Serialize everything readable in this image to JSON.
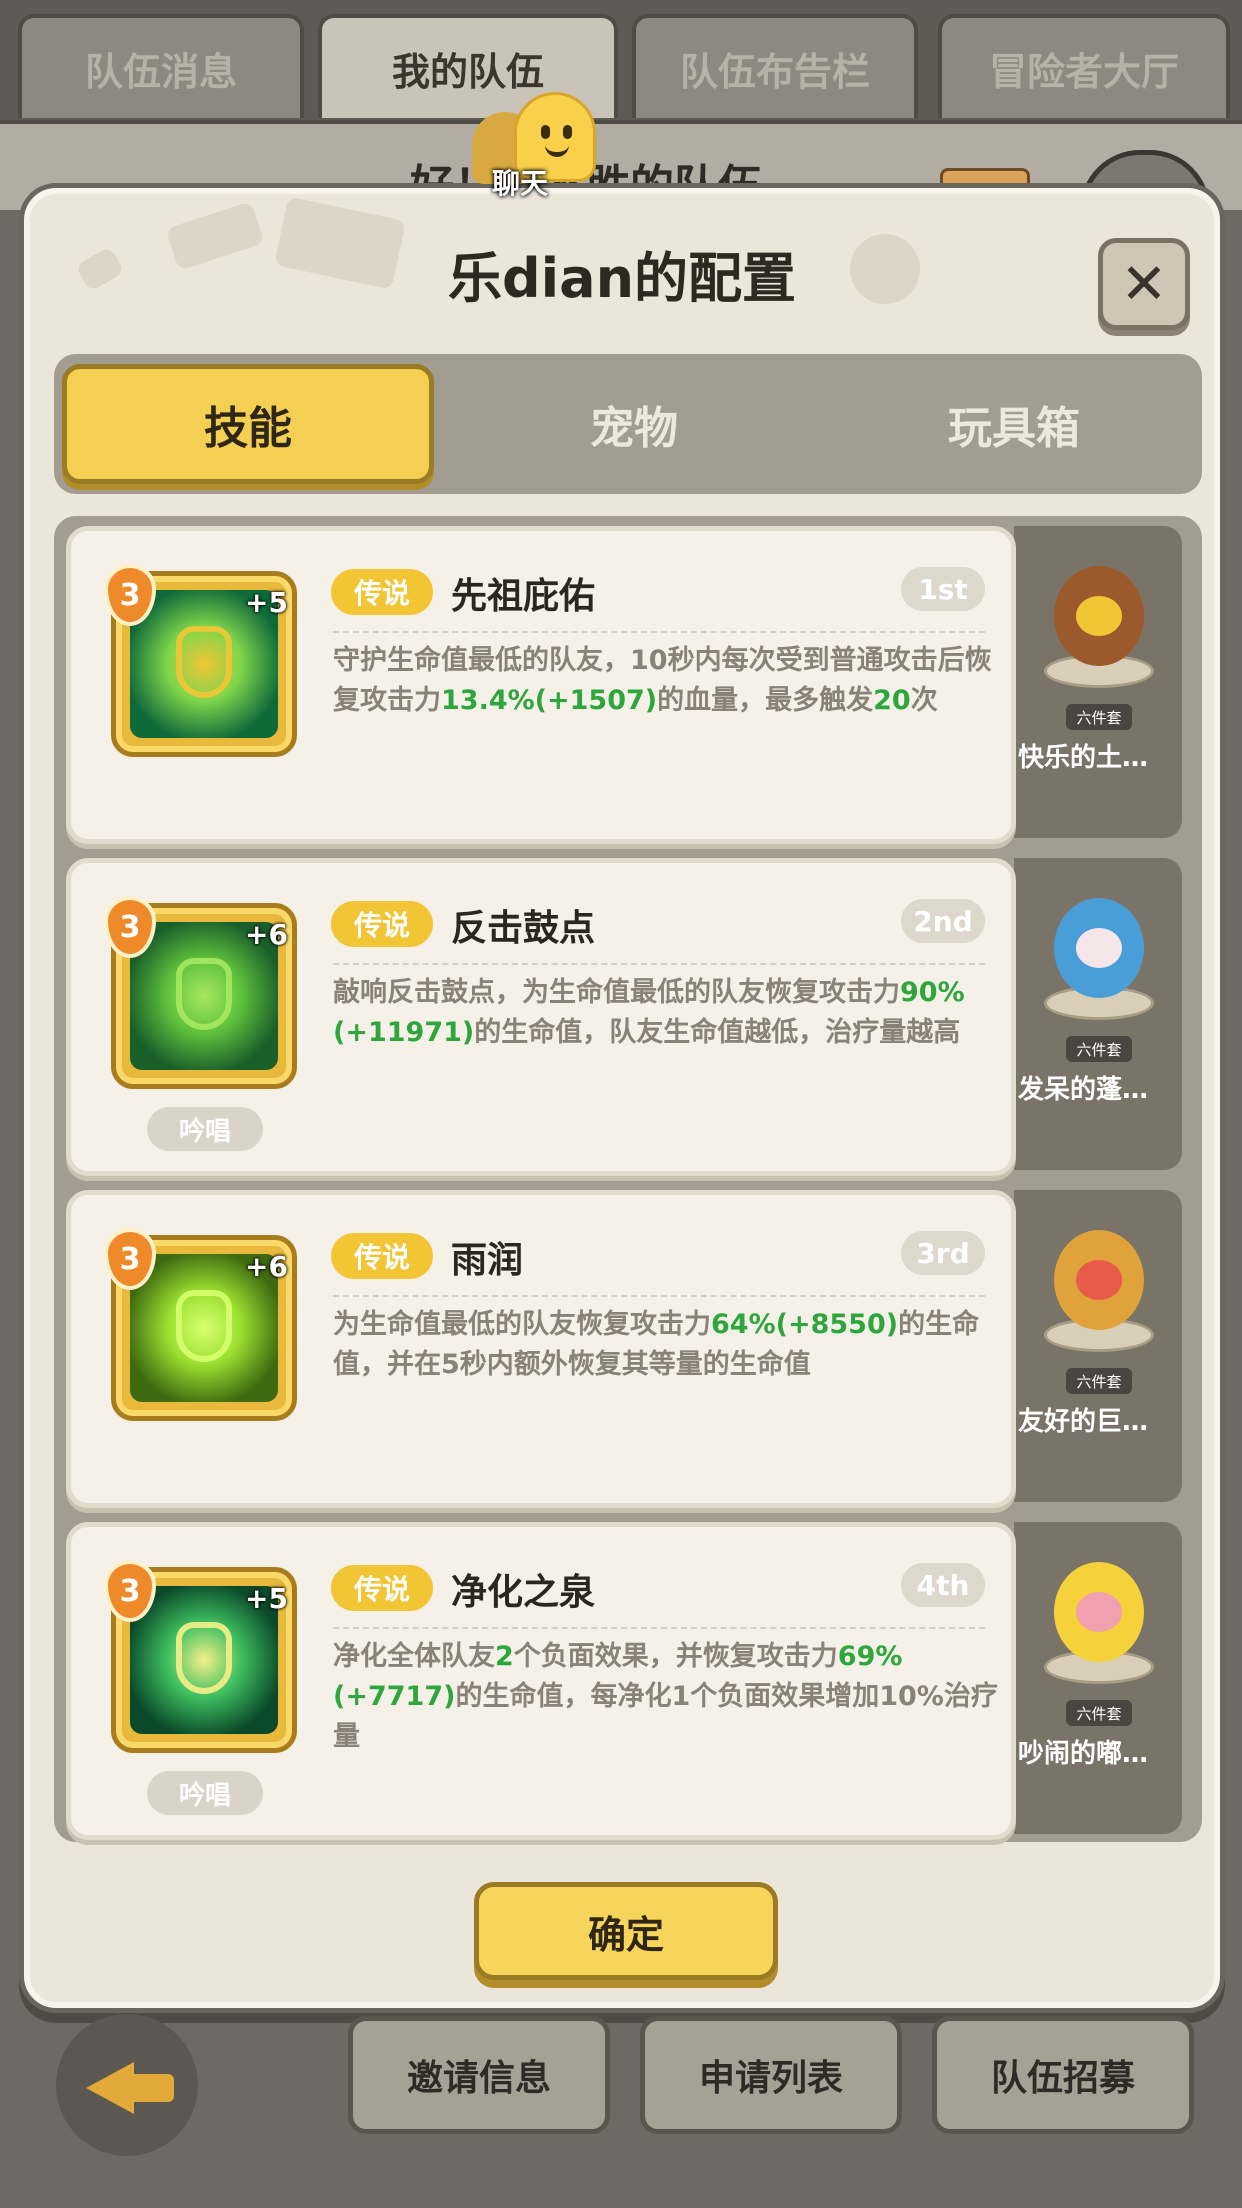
{
  "top_tabs": [
    "队伍消息",
    "我的队伍",
    "队伍布告栏",
    "冒险者大厅"
  ],
  "background_title": "好！冲不胜的队伍",
  "chat_label": "聊天",
  "dialog": {
    "title": "乐dian的配置",
    "close_symbol": "✕",
    "tabs": [
      "技能",
      "宠物",
      "玩具箱"
    ],
    "active_tab": "技能",
    "confirm_label": "确定"
  },
  "skills": [
    {
      "level": "3",
      "plus": "+5",
      "rarity": "传说",
      "name": "先祖庇佑",
      "rank": "1st",
      "chant": "",
      "desc": [
        {
          "t": "守护生命值最低的队友，10秒内每次受到普通攻击后恢复攻击力"
        },
        {
          "t": "13.4%(+1507)",
          "g": true
        },
        {
          "t": "的血量，最多触发"
        },
        {
          "t": "20",
          "g": true
        },
        {
          "t": "次"
        }
      ],
      "icon_colors": [
        "#0f6a3a",
        "#7fd64a",
        "#f2c535"
      ]
    },
    {
      "level": "3",
      "plus": "+6",
      "rarity": "传说",
      "name": "反击鼓点",
      "rank": "2nd",
      "chant": "吟唱",
      "desc": [
        {
          "t": "敲响反击鼓点，为生命值最低的队友恢复攻击力"
        },
        {
          "t": "90%(+11971)",
          "g": true
        },
        {
          "t": "的生命值，队友生命值越低，治疗量越高"
        }
      ],
      "icon_colors": [
        "#1a5e2a",
        "#5fc23c",
        "#a8e860"
      ]
    },
    {
      "level": "3",
      "plus": "+6",
      "rarity": "传说",
      "name": "雨润",
      "rank": "3rd",
      "chant": "",
      "desc": [
        {
          "t": "为生命值最低的队友恢复攻击力"
        },
        {
          "t": "64%(+8550)",
          "g": true
        },
        {
          "t": "的生命值，并在5秒内额外恢复其等量的生命值"
        }
      ],
      "icon_colors": [
        "#3f6a10",
        "#9be030",
        "#d8ff70"
      ]
    },
    {
      "level": "3",
      "plus": "+5",
      "rarity": "传说",
      "name": "净化之泉",
      "rank": "4th",
      "chant": "吟唱",
      "desc": [
        {
          "t": "净化全体队友"
        },
        {
          "t": "2",
          "g": true
        },
        {
          "t": "个负面效果，并恢复攻击力"
        },
        {
          "t": "69%(+7717)",
          "g": true
        },
        {
          "t": "的生命值，每净化1个负面效果增加10%治疗量"
        }
      ],
      "icon_colors": [
        "#0a4a2a",
        "#3fc060",
        "#f6f08a"
      ]
    }
  ],
  "pets": [
    {
      "name": "快乐的土…",
      "badge": "六件套",
      "color": "#9c5a2c",
      "accent": "#f2c535"
    },
    {
      "name": "发呆的蓬…",
      "badge": "六件套",
      "color": "#4a9ed8",
      "accent": "#f5e6ea"
    },
    {
      "name": "友好的巨…",
      "badge": "六件套",
      "color": "#e0a23a",
      "accent": "#e85a4a"
    },
    {
      "name": "吵闹的嘟…",
      "badge": "六件套",
      "color": "#f5d23a",
      "accent": "#f2a0b0"
    }
  ],
  "bottom_buttons": [
    "邀请信息",
    "申请列表",
    "队伍招募"
  ]
}
